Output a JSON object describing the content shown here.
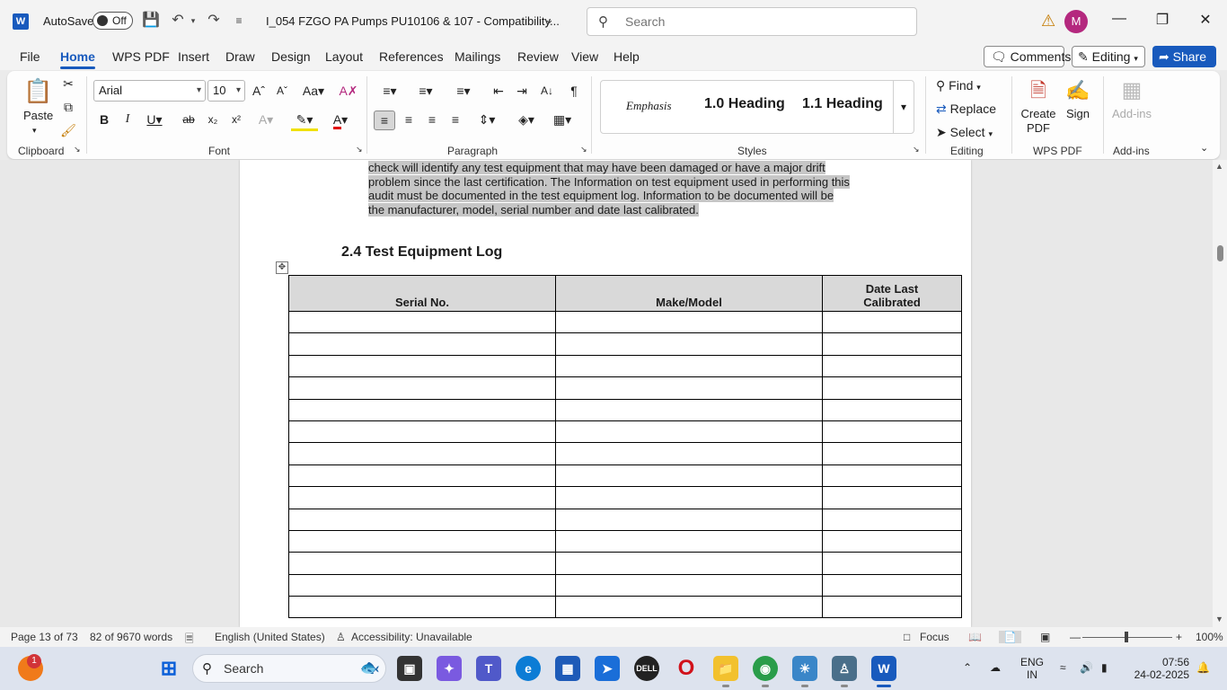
{
  "titlebar": {
    "app_logo": "W",
    "autosave_label": "AutoSave",
    "autosave_state": "Off",
    "doc_title": "I_054 FZGO PA Pumps PU10106 & 107  -  Compatibility...",
    "search_placeholder": "Search",
    "avatar_initial": "M"
  },
  "tabs": [
    "File",
    "Home",
    "WPS PDF",
    "Insert",
    "Draw",
    "Design",
    "Layout",
    "References",
    "Mailings",
    "Review",
    "View",
    "Help"
  ],
  "active_tab": "Home",
  "ribbon_right": {
    "comments": "Comments",
    "editing": "Editing",
    "share": "Share"
  },
  "clipboard": {
    "paste": "Paste",
    "group": "Clipboard"
  },
  "font": {
    "name": "Arial",
    "size": "10",
    "group": "Font"
  },
  "paragraph": {
    "group": "Paragraph"
  },
  "styles": {
    "items": [
      "Emphasis",
      "1.0  Heading",
      "1.1  Heading"
    ],
    "group": "Styles"
  },
  "editing": {
    "find": "Find",
    "replace": "Replace",
    "select": "Select",
    "group": "Editing"
  },
  "wps": {
    "create": "Create",
    "pdf": "PDF",
    "sign": "Sign",
    "group": "WPS PDF"
  },
  "addins": {
    "label": "Add-ins",
    "group": "Add-ins"
  },
  "document": {
    "para_lines": [
      "check will identify any test equipment that may have been damaged or have a major drift",
      "problem since the last certification. The Information on test equipment used in performing this",
      "audit must be documented in the test equipment log. Information to be documented will be",
      "the manufacturer, model, serial number and date last calibrated."
    ],
    "heading": "2.4  Test Equipment Log",
    "table_headers": [
      "Serial No.",
      "Make/Model",
      "Date Last Calibrated"
    ],
    "empty_rows": 14
  },
  "statusbar": {
    "page": "Page 13 of 73",
    "words": "82 of 9670 words",
    "language": "English (United States)",
    "accessibility": "Accessibility: Unavailable",
    "focus": "Focus",
    "zoom": "100%"
  },
  "taskbar": {
    "search": "Search",
    "badge": "1",
    "lang": "ENG",
    "region": "IN",
    "time": "07:56",
    "date": "24-02-2025"
  }
}
